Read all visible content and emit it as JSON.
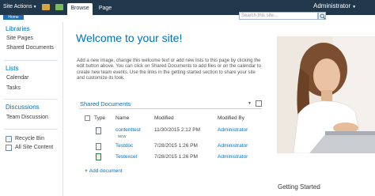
{
  "ribbon": {
    "site_actions": "Site Actions",
    "tabs": [
      "Browse",
      "Page"
    ],
    "user": "Administrator"
  },
  "header": {
    "home_tab": "Home",
    "search_placeholder": "Search this site..."
  },
  "leftnav": {
    "sections": [
      {
        "heading": "Libraries",
        "items": [
          "Site Pages",
          "Shared Documents"
        ]
      },
      {
        "heading": "Lists",
        "items": [
          "Calendar",
          "Tasks"
        ]
      },
      {
        "heading": "Discussions",
        "items": [
          "Team Discussion"
        ]
      }
    ],
    "footer": [
      "Recycle Bin",
      "All Site Content"
    ]
  },
  "main": {
    "title": "Welcome to your site!",
    "intro": "Add a new image, change this welcome text or add new lists to this page by clicking the edit button above. You can click on Shared Documents to add files or on the calendar to create new team events. Use the links in the getting started section to share your site and customize its look.",
    "library": {
      "title": "Shared Documents",
      "columns": [
        "Type",
        "Name",
        "Modified",
        "Modified By"
      ],
      "rows": [
        {
          "name": "contenttest",
          "new": "NEW",
          "modified": "11/30/2015 2:12 PM",
          "by": "Administrator",
          "icon": "word-doc-icon"
        },
        {
          "name": "Testdoc",
          "modified": "7/28/2015 1:26 PM",
          "by": "Administrator",
          "icon": "word-doc-icon"
        },
        {
          "name": "Testexcel",
          "modified": "7/28/2015 1:26 PM",
          "by": "Administrator",
          "icon": "excel-doc-icon"
        }
      ],
      "add_label": "Add document"
    }
  },
  "sidebar": {
    "getting_started": "Getting Started"
  },
  "colors": {
    "ribbon": "#21374c",
    "link": "#0072bc"
  }
}
